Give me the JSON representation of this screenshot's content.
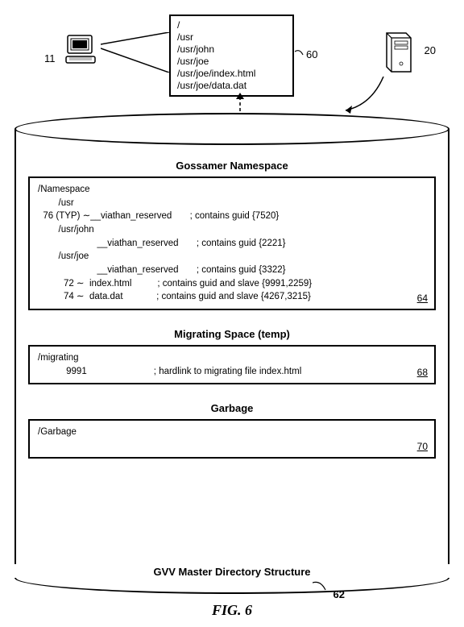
{
  "labels": {
    "l11": "11",
    "l60": "60",
    "l20": "20",
    "l62": "62",
    "l64": "64",
    "l68": "68",
    "l70": "70"
  },
  "pathbox": {
    "p1": "/",
    "p2": "/usr",
    "p3": "/usr/john",
    "p4": "/usr/joe",
    "p5": "/usr/joe/index.html",
    "p6": "/usr/joe/data.dat"
  },
  "sections": {
    "ns_title": "Gossamer Namespace",
    "mig_title": "Migrating Space (temp)",
    "gar_title": "Garbage"
  },
  "ns": {
    "l1": "/Namespace",
    "l2": "        /usr",
    "l3": "  76 (TYP) ∼__viathan_reserved       ; contains guid {7520}",
    "l4": "        /usr/john",
    "l5": "                       __viathan_reserved       ; contains guid {2221}",
    "l6": "        /usr/joe",
    "l7": "                       __viathan_reserved       ; contains guid {3322}",
    "l8": "          72 ∼  index.html          ; contains guid and slave {9991,2259}",
    "l9": "          74 ∼  data.dat             ; contains guid and slave {4267,3215}"
  },
  "mig": {
    "l1": "/migrating",
    "l2": "           9991                          ; hardlink to migrating file index.html"
  },
  "gar": {
    "l1": "/Garbage"
  },
  "bottom": "GVV Master Directory Structure",
  "fig": "FIG. 6"
}
